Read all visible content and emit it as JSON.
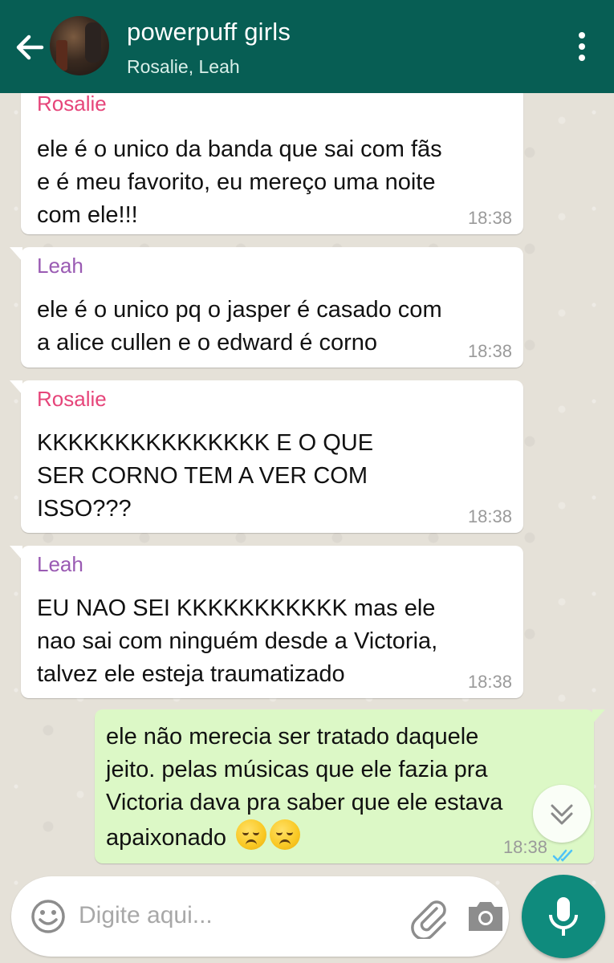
{
  "header": {
    "title": "powerpuff girls",
    "subtitle": "Rosalie, Leah"
  },
  "messages": [
    {
      "sender": "Rosalie",
      "lines": [
        "ele é o unico da banda que sai com fãs",
        "e é meu favorito, eu mereço uma noite",
        "com ele!!!"
      ],
      "time": "18:38"
    },
    {
      "sender": "Leah",
      "lines": [
        "ele é o unico pq o jasper é casado com",
        "a alice cullen e o edward é corno"
      ],
      "time": "18:38"
    },
    {
      "sender": "Rosalie",
      "lines": [
        "KKKKKKKKKKKKKKK E O QUE",
        "SER CORNO TEM A VER COM",
        "ISSO???"
      ],
      "time": "18:38"
    },
    {
      "sender": "Leah",
      "lines": [
        "EU NAO SEI KKKKKKKKKKK mas ele",
        "nao sai com ninguém desde a Victoria,",
        "talvez ele esteja traumatizado"
      ],
      "time": "18:38"
    }
  ],
  "outgoing": {
    "lines": [
      "ele não merecia ser tratado daquele",
      "jeito. pelas músicas que ele fazia pra",
      "Victoria dava pra saber que ele estava",
      "apaixonado"
    ],
    "emojis": [
      "disappointed-face",
      "disappointed-face"
    ],
    "time": "18:38",
    "status": "read"
  },
  "input": {
    "placeholder": "Digite aqui..."
  },
  "colors": {
    "header": "#075e54",
    "rosalie": "#e6457a",
    "leah": "#9a5bb3",
    "outgoing_bubble": "#dcf8c6",
    "mic_button": "#0f8b7d",
    "read_ticks": "#4fc3f7"
  }
}
